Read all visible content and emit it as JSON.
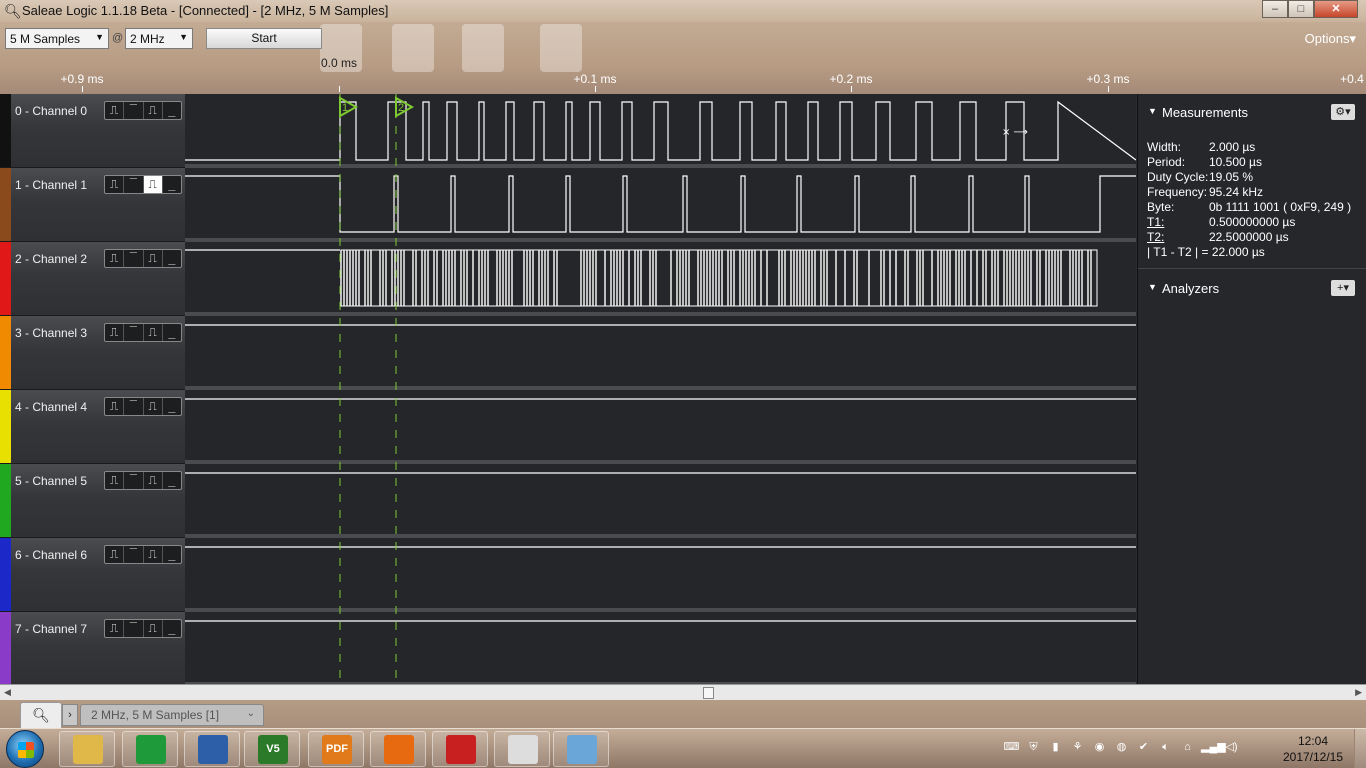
{
  "window": {
    "title": "Saleae Logic 1.1.18 Beta - [Connected] - [2 MHz, 5 M Samples]",
    "buttons": {
      "minimize": "–",
      "maximize": "□",
      "close": "✕"
    }
  },
  "toolbar": {
    "samples_value": "5 M Samples",
    "at_symbol": "@",
    "rate_value": "2 MHz",
    "start_label": "Start",
    "options_label": "Options▾"
  },
  "timeline": {
    "zero": "0.0 ms",
    "labels": [
      "+0.9 ms",
      "+0.1 ms",
      "+0.2 ms",
      "+0.3 ms",
      "+0.4"
    ]
  },
  "channels": [
    {
      "label": "0 - Channel 0",
      "color": "#111111",
      "active_trigger": null
    },
    {
      "label": "1 - Channel 1",
      "color": "#8b4a1c",
      "active_trigger": 2
    },
    {
      "label": "2 - Channel 2",
      "color": "#e01818",
      "active_trigger": null
    },
    {
      "label": "3 - Channel 3",
      "color": "#f08a00",
      "active_trigger": null
    },
    {
      "label": "4 - Channel 4",
      "color": "#e8e000",
      "active_trigger": null
    },
    {
      "label": "5 - Channel 5",
      "color": "#21a821",
      "active_trigger": null
    },
    {
      "label": "6 - Channel 6",
      "color": "#1c28c8",
      "active_trigger": null
    },
    {
      "label": "7 - Channel 7",
      "color": "#8a3cc8",
      "active_trigger": null
    }
  ],
  "trigger_glyphs": [
    "⎍",
    "‾",
    "⎍",
    "_"
  ],
  "markers": {
    "t1": "1",
    "t2": "2",
    "color": "#7ec832"
  },
  "measurements": {
    "header": "Measurements",
    "rows": [
      {
        "key": "Width:",
        "value": "2.000 µs"
      },
      {
        "key": "Period:",
        "value": "10.500 µs"
      },
      {
        "key": "Duty Cycle:",
        "value": "19.05 %"
      },
      {
        "key": "Frequency:",
        "value": "95.24 kHz"
      },
      {
        "key": "Byte:",
        "value": "0b  1111  1001  ( 0xF9, 249 )"
      },
      {
        "key": "T1:",
        "value": "0.500000000 µs"
      },
      {
        "key": "T2:",
        "value": "22.5000000 µs"
      }
    ],
    "diff": "| T1 - T2 | = 22.000 µs"
  },
  "analyzers": {
    "header": "Analyzers"
  },
  "tabs": {
    "search_icon": "search-icon",
    "nav": "›",
    "session": "2 MHz, 5 M Samples [1]",
    "chevron": "⌄"
  },
  "taskbar": {
    "time": "12:04",
    "date": "2017/12/15",
    "apps": [
      {
        "name": "file-explorer",
        "label": "",
        "color": "#e0b84a"
      },
      {
        "name": "green-app",
        "label": "",
        "color": "#1f9a3a"
      },
      {
        "name": "saleae-app",
        "label": "",
        "color": "#2c5fa8"
      },
      {
        "name": "vs-app",
        "label": "V5",
        "color": "#2a7a2a"
      },
      {
        "name": "pdf-app",
        "label": "PDF",
        "color": "#e07a1a"
      },
      {
        "name": "uc-browser",
        "label": "",
        "color": "#e86a10"
      },
      {
        "name": "cards-game",
        "label": "",
        "color": "#c82020"
      },
      {
        "name": "sd-tool",
        "label": "",
        "color": "#dddddd"
      },
      {
        "name": "notes-app",
        "label": "",
        "color": "#6aa6d8"
      }
    ]
  }
}
